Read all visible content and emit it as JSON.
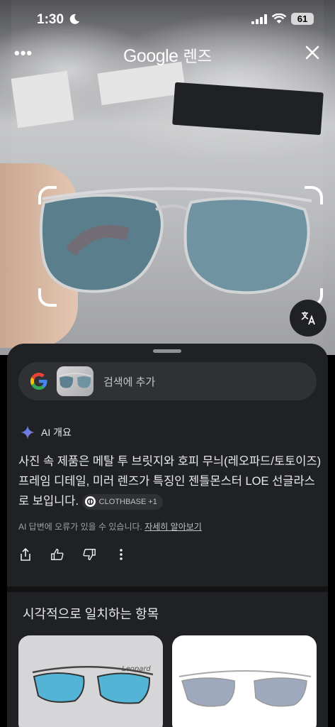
{
  "status_bar": {
    "time": "1:30",
    "battery": "61"
  },
  "top_bar": {
    "brand": "Google",
    "product": "렌즈"
  },
  "add_to_search": {
    "label": "검색에 추가"
  },
  "ai_overview": {
    "title": "AI 개요",
    "body": "사진 속 제품은 메탈 투 브릿지와 호피 무늬(레오파드/토토이즈) 프레임 디테일, 미러 렌즈가 특징인 젠틀몬스터 LOE 선글라스로 보입니다.",
    "source_chip": "CLOTHBASE +1",
    "disclaimer": "AI 답변에 오류가 있을 수 있습니다.",
    "learn_more": "자세히 알아보기"
  },
  "visual_matches": {
    "title": "시각적으로 일치하는 항목",
    "card1_watermark": "Leopard"
  },
  "colors": {
    "sheet_bg": "#202124",
    "accent_blue": "#4285f4"
  }
}
